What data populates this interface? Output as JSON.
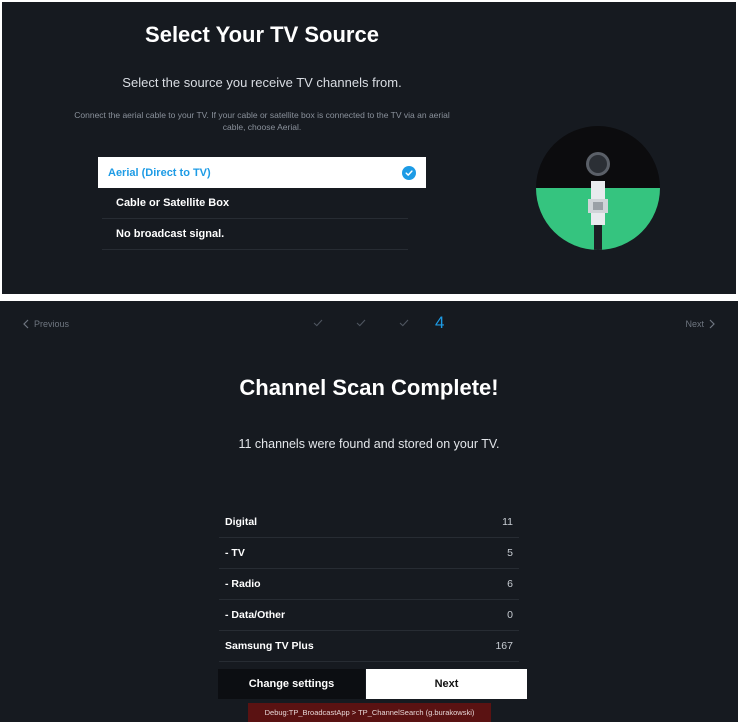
{
  "source_screen": {
    "title": "Select Your TV Source",
    "subtitle": "Select the source you receive TV channels from.",
    "description": "Connect the aerial cable to your TV. If your cable or satellite box is connected to the TV via an aerial cable, choose Aerial.",
    "options": [
      {
        "label": "Aerial (Direct to TV)",
        "selected": true
      },
      {
        "label": "Cable or Satellite Box",
        "selected": false
      },
      {
        "label": "No broadcast signal.",
        "selected": false
      }
    ],
    "illustration_icon": "aerial-cable-icon"
  },
  "scan_screen": {
    "nav": {
      "previous": "Previous",
      "next": "Next"
    },
    "steps": {
      "completed_count": 3,
      "current": "4"
    },
    "title": "Channel Scan Complete!",
    "subtitle": "11 channels were found and stored on your TV.",
    "results": [
      {
        "label": "Digital",
        "value": "11"
      },
      {
        "label": " - TV",
        "value": "5"
      },
      {
        "label": " - Radio",
        "value": "6"
      },
      {
        "label": " - Data/Other",
        "value": "0"
      },
      {
        "label": "Samsung TV Plus",
        "value": "167"
      }
    ],
    "buttons": {
      "change_settings": "Change settings",
      "next": "Next"
    },
    "debug": "Debug:TP_BroadcastApp > TP_ChannelSearch (g.burakowski)"
  },
  "colors": {
    "background": "#161a20",
    "accent": "#1d9be5",
    "illustration_green": "#35c47f",
    "debug_bar": "#5a1212"
  }
}
